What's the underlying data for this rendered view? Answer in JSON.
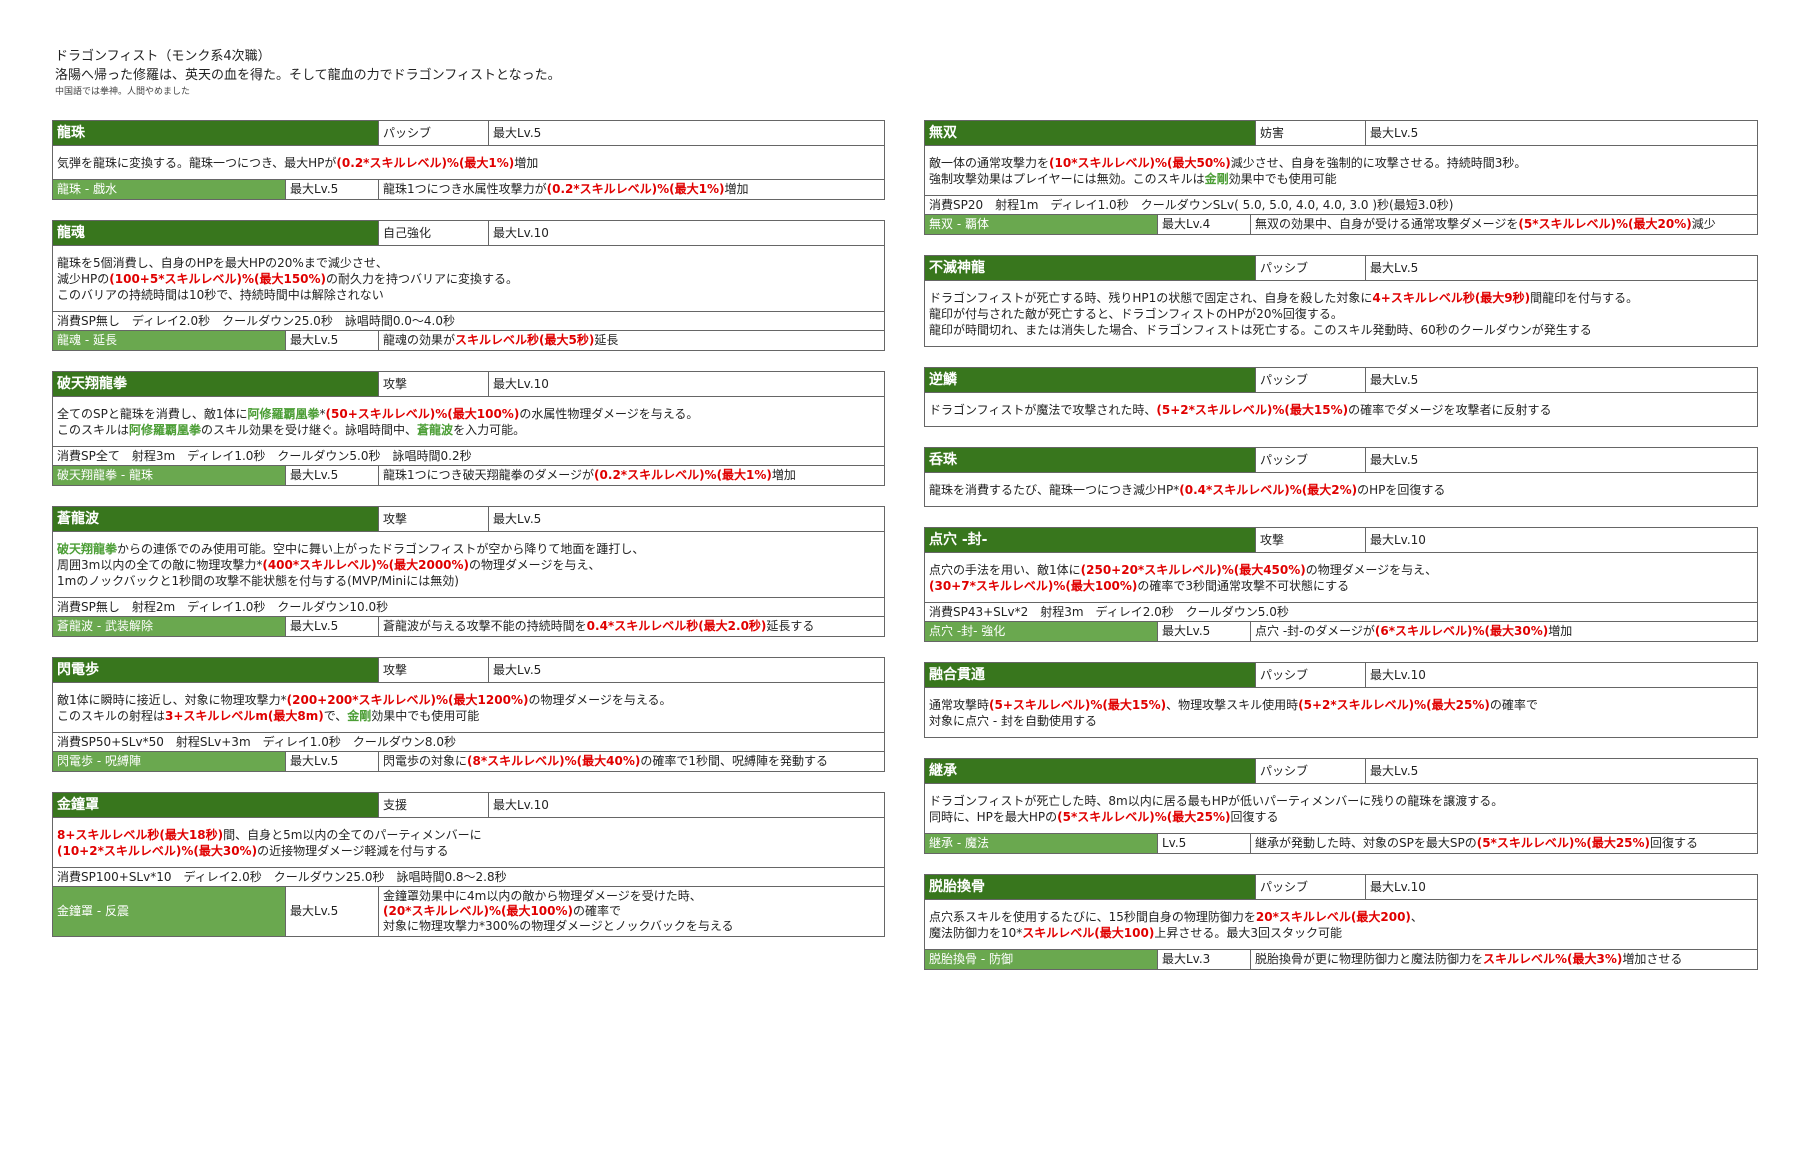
{
  "header": {
    "title": "ドラゴンフィスト（モンク系4次職）",
    "subtitle": "洛陽へ帰った修羅は、英天の血を得た。そして龍血の力でドラゴンフィストとなった。",
    "note": "中国語では拳神。人間やめました"
  },
  "left": [
    {
      "name": "龍珠",
      "type": "パッシブ",
      "lv": "最大Lv.5",
      "desc": [
        [
          {
            "t": "気弾を龍珠に変換する。龍珠一つにつき、最大HPが"
          },
          {
            "t": "(0.2*スキルレベル)%(最大1%)",
            "c": "red"
          },
          {
            "t": "増加"
          }
        ]
      ],
      "sub": {
        "name": "龍珠 - 戯水",
        "lv": "最大Lv.5",
        "desc": [
          [
            {
              "t": "龍珠1つにつき水属性攻撃力が"
            },
            {
              "t": "(0.2*スキルレベル)%(最大1%)",
              "c": "red"
            },
            {
              "t": "増加"
            }
          ]
        ]
      }
    },
    {
      "name": "龍魂",
      "type": "自己強化",
      "lv": "最大Lv.10",
      "desc": [
        [
          {
            "t": "龍珠を5個消費し、自身のHPを最大HPの20%まで減少させ、"
          }
        ],
        [
          {
            "t": "減少HPの"
          },
          {
            "t": "(100+5*スキルレベル)%(最大150%)",
            "c": "red"
          },
          {
            "t": "の耐久力を持つバリアに変換する。"
          }
        ],
        [
          {
            "t": "このバリアの持続時間は10秒で、持続時間中は解除されない"
          }
        ]
      ],
      "meta": "消費SP無し　ディレイ2.0秒　クールダウン25.0秒　詠唱時間0.0～4.0秒",
      "sub": {
        "name": "龍魂 - 延長",
        "lv": "最大Lv.5",
        "desc": [
          [
            {
              "t": "龍魂の効果が"
            },
            {
              "t": "スキルレベル秒(最大5秒)",
              "c": "red"
            },
            {
              "t": "延長"
            }
          ]
        ]
      }
    },
    {
      "name": "破天翔龍拳",
      "type": "攻撃",
      "lv": "最大Lv.10",
      "desc": [
        [
          {
            "t": "全てのSPと龍珠を消費し、敵1体に"
          },
          {
            "t": "阿修羅覇凰拳",
            "c": "grn"
          },
          {
            "t": "*"
          },
          {
            "t": "(50+スキルレベル)%(最大100%)",
            "c": "red"
          },
          {
            "t": "の水属性物理ダメージを与える。"
          }
        ],
        [
          {
            "t": "このスキルは"
          },
          {
            "t": "阿修羅覇凰拳",
            "c": "grn"
          },
          {
            "t": "のスキル効果を受け継ぐ。詠唱時間中、"
          },
          {
            "t": "蒼龍波",
            "c": "grn"
          },
          {
            "t": "を入力可能。"
          }
        ]
      ],
      "meta": "消費SP全て　射程3m　ディレイ1.0秒　クールダウン5.0秒　詠唱時間0.2秒",
      "sub": {
        "name": "破天翔龍拳 - 龍珠",
        "lv": "最大Lv.5",
        "desc": [
          [
            {
              "t": "龍珠1つにつき破天翔龍拳のダメージが"
            },
            {
              "t": "(0.2*スキルレベル)%(最大1%)",
              "c": "red"
            },
            {
              "t": "増加"
            }
          ]
        ]
      }
    },
    {
      "name": "蒼龍波",
      "type": "攻撃",
      "lv": "最大Lv.5",
      "desc": [
        [
          {
            "t": "破天翔龍拳",
            "c": "grn"
          },
          {
            "t": "からの連係でのみ使用可能。空中に舞い上がったドラゴンフィストが空から降りて地面を踵打し、"
          }
        ],
        [
          {
            "t": "周囲3m以内の全ての敵に物理攻撃力*"
          },
          {
            "t": "(400*スキルレベル)%(最大2000%)",
            "c": "red"
          },
          {
            "t": "の物理ダメージを与え、"
          }
        ],
        [
          {
            "t": "1mのノックバックと1秒間の攻撃不能状態を付与する(MVP/Miniには無効)"
          }
        ]
      ],
      "meta": "消費SP無し　射程2m　ディレイ1.0秒　クールダウン10.0秒",
      "sub": {
        "name": "蒼龍波 - 武装解除",
        "lv": "最大Lv.5",
        "desc": [
          [
            {
              "t": "蒼龍波が与える攻撃不能の持続時間を"
            },
            {
              "t": "0.4*スキルレベル秒(最大2.0秒)",
              "c": "red"
            },
            {
              "t": "延長する"
            }
          ]
        ]
      }
    },
    {
      "name": "閃電歩",
      "type": "攻撃",
      "lv": "最大Lv.5",
      "desc": [
        [
          {
            "t": "敵1体に瞬時に接近し、対象に物理攻撃力*"
          },
          {
            "t": "(200+200*スキルレベル)%(最大1200%)",
            "c": "red"
          },
          {
            "t": "の物理ダメージを与える。"
          }
        ],
        [
          {
            "t": "このスキルの射程は"
          },
          {
            "t": "3+スキルレベルm(最大8m)",
            "c": "red"
          },
          {
            "t": "で、"
          },
          {
            "t": "金剛",
            "c": "grn"
          },
          {
            "t": "効果中でも使用可能"
          }
        ]
      ],
      "meta": "消費SP50+SLv*50　射程SLv+3m　ディレイ1.0秒　クールダウン8.0秒",
      "sub": {
        "name": "閃電歩 - 呪縛陣",
        "lv": "最大Lv.5",
        "desc": [
          [
            {
              "t": "閃電歩の対象に"
            },
            {
              "t": "(8*スキルレベル)%(最大40%)",
              "c": "red"
            },
            {
              "t": "の確率で1秒間、呪縛陣を発動する"
            }
          ]
        ]
      }
    },
    {
      "name": "金鐘罩",
      "type": "支援",
      "lv": "最大Lv.10",
      "desc": [
        [
          {
            "t": "8+スキルレベル秒(最大18秒)",
            "c": "red"
          },
          {
            "t": "間、自身と5m以内の全てのパーティメンバーに"
          }
        ],
        [
          {
            "t": "(10+2*スキルレベル)%(最大30%)",
            "c": "red"
          },
          {
            "t": "の近接物理ダメージ軽減を付与する"
          }
        ]
      ],
      "meta": "消費SP100+SLv*10　ディレイ2.0秒　クールダウン25.0秒　詠唱時間0.8～2.8秒",
      "sub": {
        "name": "金鐘罩 - 反震",
        "lv": "最大Lv.5",
        "desc": [
          [
            {
              "t": "金鐘罩効果中に4m以内の敵から物理ダメージを受けた時、"
            }
          ],
          [
            {
              "t": "(20*スキルレベル)%(最大100%)",
              "c": "red"
            },
            {
              "t": "の確率で"
            }
          ],
          [
            {
              "t": "対象に物理攻撃力*300%の物理ダメージとノックバックを与える"
            }
          ]
        ]
      }
    }
  ],
  "right": [
    {
      "name": "無双",
      "type": "妨害",
      "lv": "最大Lv.5",
      "desc": [
        [
          {
            "t": "敵一体の通常攻撃力を"
          },
          {
            "t": "(10*スキルレベル)%(最大50%)",
            "c": "red"
          },
          {
            "t": "減少させ、自身を強制的に攻撃させる。持続時間3秒。"
          }
        ],
        [
          {
            "t": "強制攻撃効果はプレイヤーには無効。このスキルは"
          },
          {
            "t": "金剛",
            "c": "grn"
          },
          {
            "t": "効果中でも使用可能"
          }
        ]
      ],
      "meta": "消費SP20　射程1m　ディレイ1.0秒　クールダウンSLv( 5.0, 5.0, 4.0, 4.0, 3.0 )秒(最短3.0秒)",
      "sub": {
        "name": "無双 - 覇体",
        "lv": "最大Lv.4",
        "desc": [
          [
            {
              "t": "無双の効果中、自身が受ける通常攻撃ダメージを"
            },
            {
              "t": "(5*スキルレベル)%(最大20%)",
              "c": "red"
            },
            {
              "t": "減少"
            }
          ]
        ]
      }
    },
    {
      "name": "不滅神龍",
      "type": "パッシブ",
      "lv": "最大Lv.5",
      "desc": [
        [
          {
            "t": "ドラゴンフィストが死亡する時、残りHP1の状態で固定され、自身を殺した対象に"
          },
          {
            "t": "4+スキルレベル秒(最大9秒)",
            "c": "red"
          },
          {
            "t": "間龍印を付与する。"
          }
        ],
        [
          {
            "t": "龍印が付与された敵が死亡すると、ドラゴンフィストのHPが20%回復する。"
          }
        ],
        [
          {
            "t": "龍印が時間切れ、または消失した場合、ドラゴンフィストは死亡する。このスキル発動時、60秒のクールダウンが発生する"
          }
        ]
      ]
    },
    {
      "name": "逆鱗",
      "type": "パッシブ",
      "lv": "最大Lv.5",
      "desc": [
        [
          {
            "t": "ドラゴンフィストが魔法で攻撃された時、"
          },
          {
            "t": "(5+2*スキルレベル)%(最大15%)",
            "c": "red"
          },
          {
            "t": "の確率でダメージを攻撃者に反射する"
          }
        ]
      ]
    },
    {
      "name": "呑珠",
      "type": "パッシブ",
      "lv": "最大Lv.5",
      "desc": [
        [
          {
            "t": "龍珠を消費するたび、龍珠一つにつき減少HP*"
          },
          {
            "t": "(0.4*スキルレベル)%(最大2%)",
            "c": "red"
          },
          {
            "t": "のHPを回復する"
          }
        ]
      ]
    },
    {
      "name": "点穴 -封-",
      "type": "攻撃",
      "lv": "最大Lv.10",
      "desc": [
        [
          {
            "t": "点穴の手法を用い、敵1体に"
          },
          {
            "t": "(250+20*スキルレベル)%(最大450%)",
            "c": "red"
          },
          {
            "t": "の物理ダメージを与え、"
          }
        ],
        [
          {
            "t": "(30+7*スキルレベル)%(最大100%)",
            "c": "red"
          },
          {
            "t": "の確率で3秒間通常攻撃不可状態にする"
          }
        ]
      ],
      "meta": "消費SP43+SLv*2　射程3m　ディレイ2.0秒　クールダウン5.0秒",
      "sub": {
        "name": "点穴 -封- 強化",
        "lv": "最大Lv.5",
        "desc": [
          [
            {
              "t": "点穴 -封-のダメージが"
            },
            {
              "t": "(6*スキルレベル)%(最大30%)",
              "c": "red"
            },
            {
              "t": "増加"
            }
          ]
        ]
      }
    },
    {
      "name": "融合貫通",
      "type": "パッシブ",
      "lv": "最大Lv.10",
      "desc": [
        [
          {
            "t": "通常攻撃時"
          },
          {
            "t": "(5+スキルレベル)%(最大15%)",
            "c": "red"
          },
          {
            "t": "、物理攻撃スキル使用時"
          },
          {
            "t": "(5+2*スキルレベル)%(最大25%)",
            "c": "red"
          },
          {
            "t": "の確率で"
          }
        ],
        [
          {
            "t": "対象に点穴 - 封を自動使用する"
          }
        ]
      ]
    },
    {
      "name": "継承",
      "type": "パッシブ",
      "lv": "最大Lv.5",
      "desc": [
        [
          {
            "t": "ドラゴンフィストが死亡した時、8m以内に居る最もHPが低いパーティメンバーに残りの龍珠を譲渡する。"
          }
        ],
        [
          {
            "t": "同時に、HPを最大HPの"
          },
          {
            "t": "(5*スキルレベル)%(最大25%)",
            "c": "red"
          },
          {
            "t": "回復する"
          }
        ]
      ],
      "sub": {
        "name": "継承 - 魔法",
        "lv": "Lv.5",
        "desc": [
          [
            {
              "t": "継承が発動した時、対象のSPを最大SPの"
            },
            {
              "t": "(5*スキルレベル)%(最大25%)",
              "c": "red"
            },
            {
              "t": "回復する"
            }
          ]
        ]
      }
    },
    {
      "name": "脱胎換骨",
      "type": "パッシブ",
      "lv": "最大Lv.10",
      "desc": [
        [
          {
            "t": "点穴系スキルを使用するたびに、15秒間自身の物理防御力を"
          },
          {
            "t": "20*スキルレベル(最大200)",
            "c": "red"
          },
          {
            "t": "、"
          }
        ],
        [
          {
            "t": "魔法防御力を10*"
          },
          {
            "t": "スキルレベル(最大100)",
            "c": "red"
          },
          {
            "t": "上昇させる。最大3回スタック可能"
          }
        ]
      ],
      "sub": {
        "name": "脱胎換骨 - 防御",
        "lv": "最大Lv.3",
        "desc": [
          [
            {
              "t": "脱胎換骨が更に物理防御力と魔法防御力を"
            },
            {
              "t": "スキルレベル%(最大3%)",
              "c": "red"
            },
            {
              "t": "増加させる"
            }
          ]
        ]
      }
    }
  ]
}
